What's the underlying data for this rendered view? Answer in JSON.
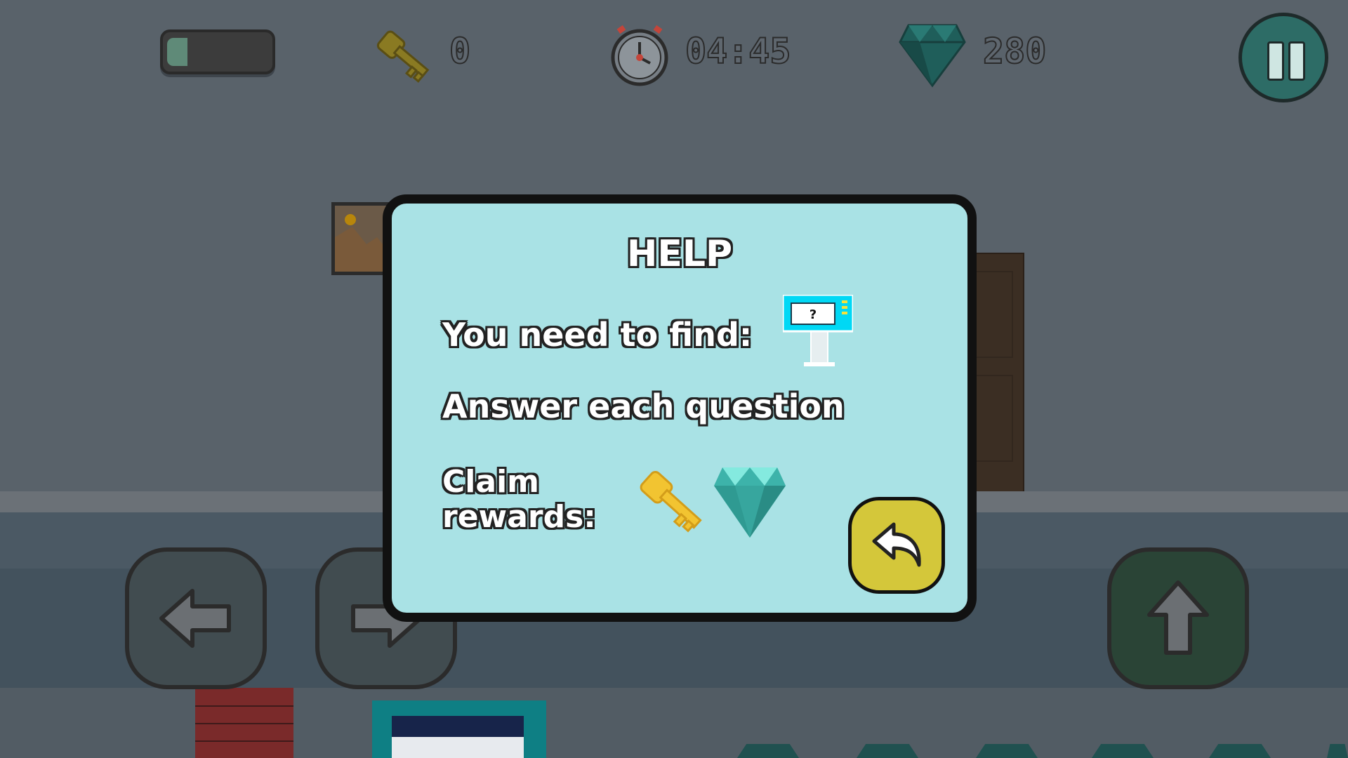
{
  "hud": {
    "energy_level": 0.05,
    "keys_count": "0",
    "timer": "04:45",
    "gems_count": "280",
    "colors": {
      "gem": "#1f5e5a",
      "key": "#8a7a22",
      "pause": "#2d6c66"
    }
  },
  "help_dialog": {
    "title": "HELP",
    "find_label": "You need to find:",
    "find_icon": "question-terminal-icon",
    "answer_label": "Answer each question",
    "claim_label_line1": "Claim",
    "claim_label_line2": "rewards:",
    "reward_icons": [
      "key-icon",
      "gem-icon"
    ],
    "back_icon": "undo-arrow-icon",
    "terminal_glyph": "?"
  },
  "controls": {
    "left_icon": "arrow-left-icon",
    "right_icon": "arrow-right-icon",
    "jump_icon": "arrow-up-icon"
  }
}
